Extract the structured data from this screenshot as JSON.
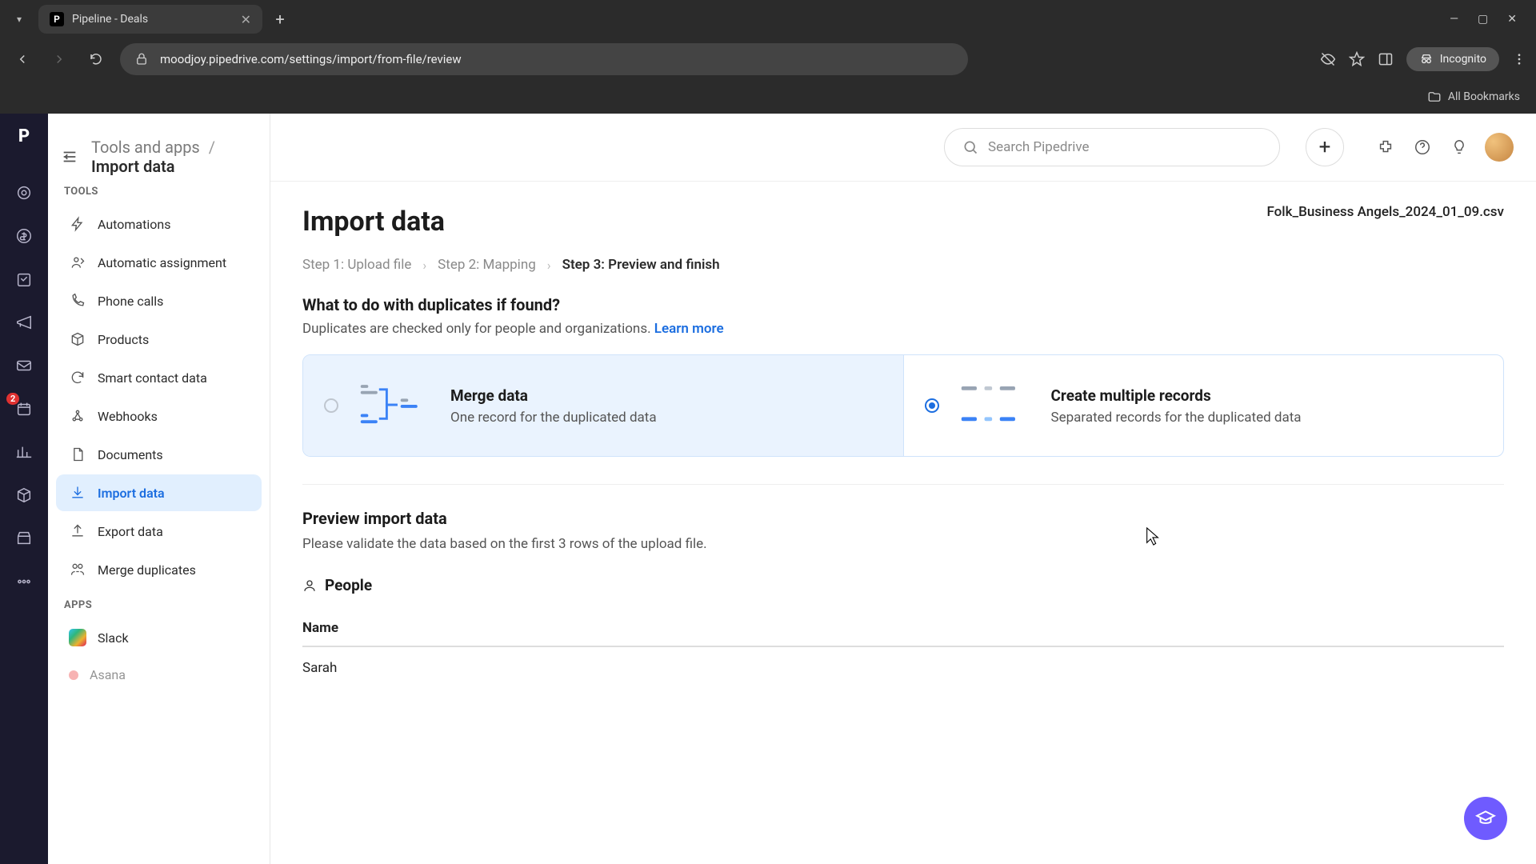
{
  "browser": {
    "tab_title": "Pipeline - Deals",
    "url": "moodjoy.pipedrive.com/settings/import/from-file/review",
    "incognito_label": "Incognito",
    "all_bookmarks_label": "All Bookmarks"
  },
  "header": {
    "breadcrumb_parent": "Tools and apps",
    "breadcrumb_current": "Import data",
    "search_placeholder": "Search Pipedrive"
  },
  "sidebar": {
    "section_tools": "TOOLS",
    "section_apps": "APPS",
    "items": [
      {
        "label": "Automations"
      },
      {
        "label": "Automatic assignment"
      },
      {
        "label": "Phone calls"
      },
      {
        "label": "Products"
      },
      {
        "label": "Smart contact data"
      },
      {
        "label": "Webhooks"
      },
      {
        "label": "Documents"
      },
      {
        "label": "Import data"
      },
      {
        "label": "Export data"
      },
      {
        "label": "Merge duplicates"
      }
    ],
    "apps": [
      {
        "label": "Slack"
      },
      {
        "label": "Asana"
      }
    ]
  },
  "rail": {
    "badge": "2"
  },
  "content": {
    "page_title": "Import data",
    "file_name": "Folk_Business Angels_2024_01_09.csv",
    "steps": [
      {
        "num": "Step 1:",
        "name": "Upload file"
      },
      {
        "num": "Step 2:",
        "name": "Mapping"
      },
      {
        "num": "Step 3:",
        "name": "Preview and finish"
      }
    ],
    "duplicates": {
      "question": "What to do with duplicates if found?",
      "subtext": "Duplicates are checked only for people and organizations. ",
      "learn_more": "Learn more",
      "options": [
        {
          "title": "Merge data",
          "sub": "One record for the duplicated data"
        },
        {
          "title": "Create multiple records",
          "sub": "Separated records for the duplicated data"
        }
      ]
    },
    "preview": {
      "title": "Preview import data",
      "subtext": "Please validate the data based on the first 3 rows of the upload file.",
      "people_label": "People",
      "columns": [
        "Name"
      ],
      "rows": [
        {
          "name": "Sarah"
        }
      ]
    }
  }
}
